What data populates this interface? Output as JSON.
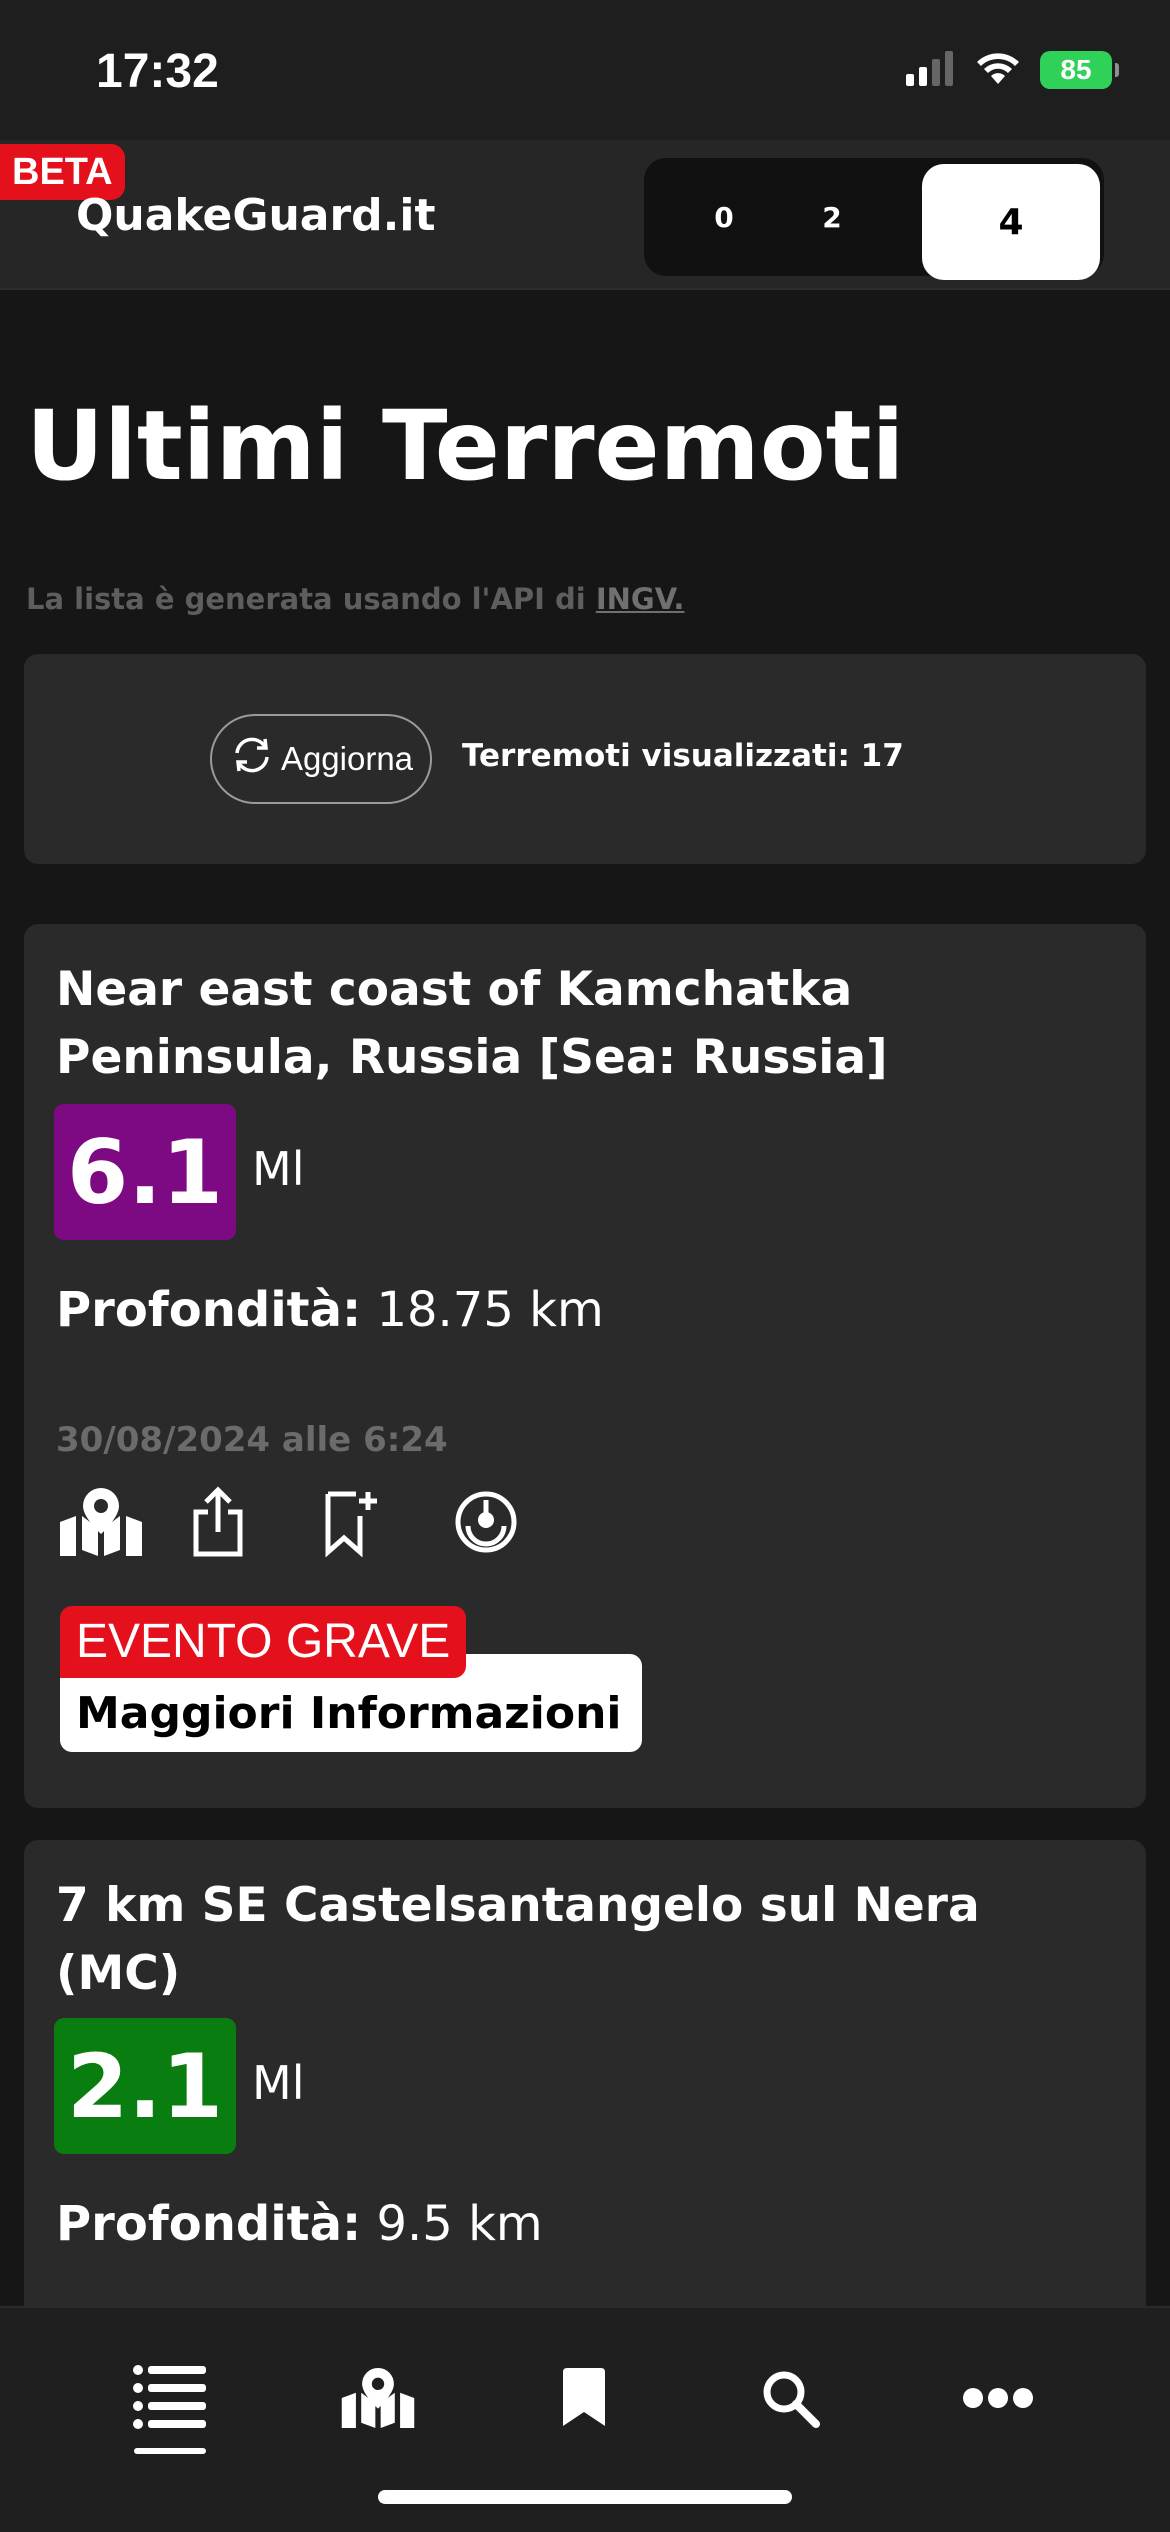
{
  "status_bar": {
    "time": "17:32",
    "battery": "85",
    "icons": [
      "signal-icon",
      "wifi-icon",
      "battery-icon"
    ]
  },
  "header": {
    "beta_badge": "BETA",
    "brand": "QuakeGuard.it",
    "segments": [
      "0",
      "2",
      "4"
    ],
    "selected_segment": "4"
  },
  "page": {
    "title": "Ultimi Terremoti",
    "api_note_prefix": "La lista è generata usando l'API di ",
    "api_link": "INGV."
  },
  "refresh": {
    "button_label": "Aggiorna",
    "count_text": "Terremoti visualizzati: 17"
  },
  "quakes": [
    {
      "location": "Near east coast of Kamchatka Peninsula, Russia [Sea: Russia]",
      "magnitude": "6.1",
      "unit": "Ml",
      "depth_label": "Profondità:",
      "depth_value": "18.75 km",
      "datetime": "30/08/2024 alle 6:24",
      "severity_badge": "EVENTO GRAVE",
      "more_info": "Maggiori Informazioni",
      "mag_color": "#7d0a82"
    },
    {
      "location": "7 km SE Castelsantangelo sul Nera (MC)",
      "magnitude": "2.1",
      "unit": "Ml",
      "depth_label": "Profondità:",
      "depth_value": "9.5 km",
      "mag_color": "#0a7d10"
    }
  ],
  "card_actions": [
    "map-icon",
    "share-icon",
    "bookmark-add-icon",
    "target-icon"
  ],
  "tab_bar": {
    "tabs": [
      "list-icon",
      "map-icon",
      "bookmark-icon",
      "search-icon",
      "more-icon"
    ],
    "active": "list-icon"
  }
}
